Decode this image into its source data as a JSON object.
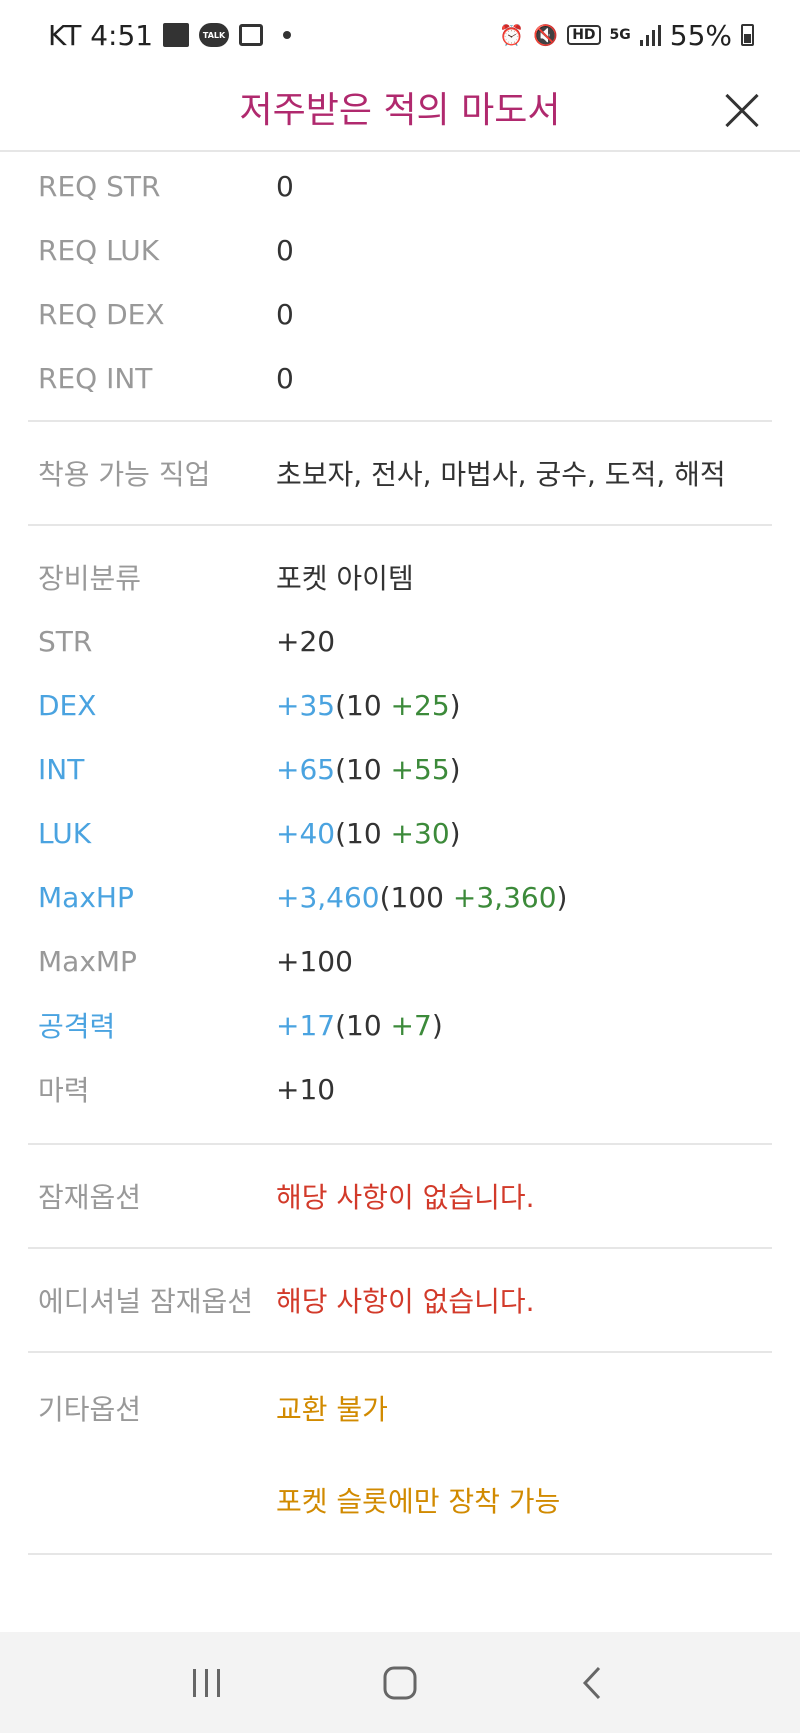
{
  "status_bar": {
    "carrier_time": "KT 4:51",
    "battery": "55%",
    "talk_label": "TALK"
  },
  "header": {
    "title": "저주받은 적의 마도서"
  },
  "requirements": [
    {
      "label": "REQ STR",
      "value": "0"
    },
    {
      "label": "REQ LUK",
      "value": "0"
    },
    {
      "label": "REQ DEX",
      "value": "0"
    },
    {
      "label": "REQ INT",
      "value": "0"
    }
  ],
  "jobs": {
    "label": "착용 가능 직업",
    "value": "초보자, 전사, 마법사, 궁수, 도적, 해적"
  },
  "stats": {
    "category": {
      "label": "장비분류",
      "value": "포켓 아이템"
    },
    "str": {
      "label": "STR",
      "value": "+20"
    },
    "dex": {
      "label": "DEX",
      "total": "+35",
      "open": "(10 ",
      "bonus": "+25",
      "close": ")"
    },
    "int": {
      "label": "INT",
      "total": "+65",
      "open": "(10 ",
      "bonus": "+55",
      "close": ")"
    },
    "luk": {
      "label": "LUK",
      "total": "+40",
      "open": "(10 ",
      "bonus": "+30",
      "close": ")"
    },
    "maxhp": {
      "label": "MaxHP",
      "total": "+3,460",
      "open": "(100 ",
      "bonus": "+3,360",
      "close": ")"
    },
    "maxmp": {
      "label": "MaxMP",
      "value": "+100"
    },
    "attack": {
      "label": "공격력",
      "total": "+17",
      "open": "(10 ",
      "bonus": "+7",
      "close": ")"
    },
    "magic": {
      "label": "마력",
      "value": "+10"
    }
  },
  "potential": {
    "label": "잠재옵션",
    "value": "해당 사항이 없습니다."
  },
  "additional_potential": {
    "label": "에디셔널 잠재옵션",
    "value": "해당 사항이 없습니다."
  },
  "etc": {
    "label": "기타옵션",
    "values": [
      "교환 불가",
      "포켓 슬롯에만 장착 가능"
    ]
  },
  "colors": {
    "title": "#b0296e",
    "enhanced": "#4aa3e0",
    "bonus": "#3c8a3a",
    "none": "#d23a2a",
    "etc": "#d18a00"
  }
}
